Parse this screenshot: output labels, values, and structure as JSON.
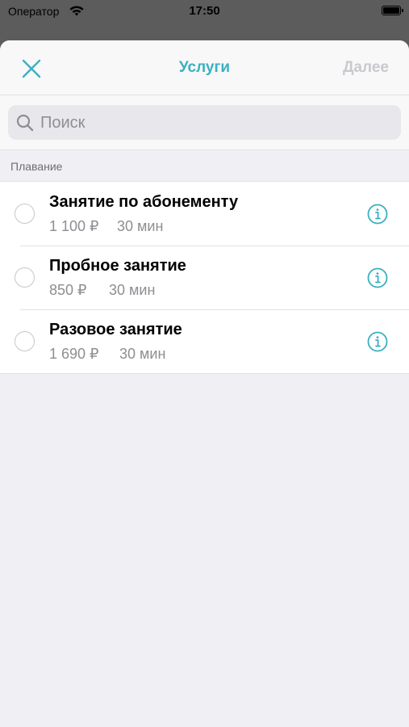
{
  "status_bar": {
    "carrier": "Оператор",
    "time": "17:50"
  },
  "navbar": {
    "title": "Услуги",
    "next_label": "Далее",
    "close_icon": "close-icon"
  },
  "search": {
    "placeholder": "Поиск",
    "value": ""
  },
  "section": {
    "title": "Плавание"
  },
  "services": [
    {
      "name": "Занятие по абонементу",
      "price": "1 100 ₽",
      "duration": "30 мин",
      "selected": false
    },
    {
      "name": "Пробное занятие",
      "price": "850 ₽",
      "duration": "30 мин",
      "selected": false
    },
    {
      "name": "Разовое занятие",
      "price": "1 690 ₽",
      "duration": "30 мин",
      "selected": false
    }
  ],
  "colors": {
    "accent": "#3bb0c1",
    "disabled": "#c9c9ce",
    "secondary_text": "#8e8e93",
    "background": "#efeff4"
  }
}
